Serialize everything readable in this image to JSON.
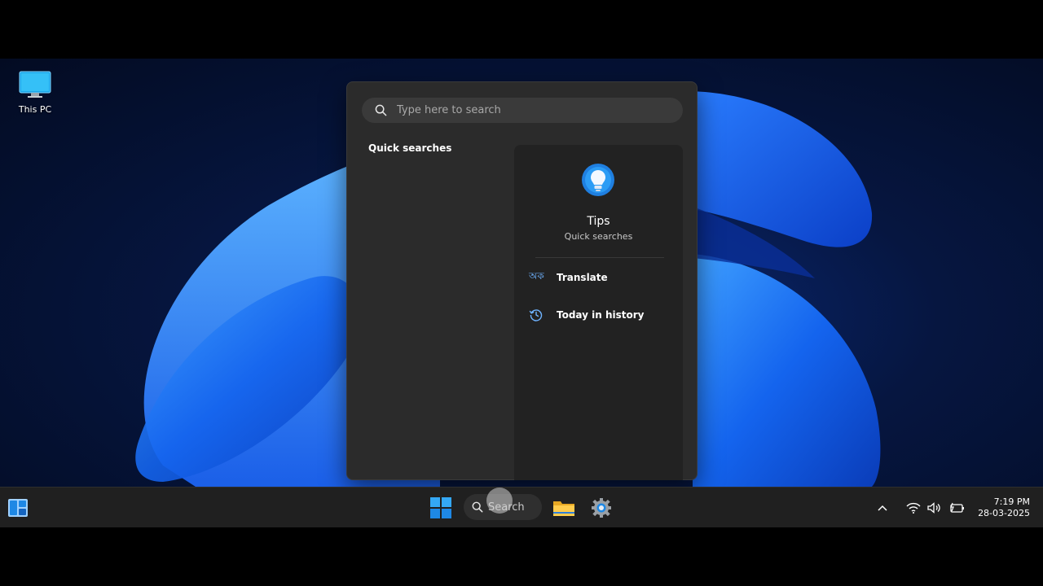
{
  "desktop": {
    "icons": [
      {
        "label": "This PC",
        "icon": "monitor-icon"
      }
    ]
  },
  "search_panel": {
    "search_placeholder": "Type here to search",
    "left_heading": "Quick searches",
    "tips_card": {
      "title": "Tips",
      "subtitle": "Quick searches",
      "items": [
        {
          "label": "Translate",
          "icon": "translate-icon",
          "glyph": "অক"
        },
        {
          "label": "Today in history",
          "icon": "history-icon"
        }
      ]
    }
  },
  "taskbar": {
    "search_label": "Search",
    "apps": [
      "widgets-icon",
      "windows-start-icon",
      "file-explorer-icon",
      "settings-icon"
    ],
    "tray": {
      "time": "7:19 PM",
      "date": "28-03-2025"
    }
  },
  "colors": {
    "panel_bg": "#2b2b2b",
    "card_bg": "#222222",
    "taskbar_bg": "#202020",
    "accent": "#1e88e5"
  }
}
